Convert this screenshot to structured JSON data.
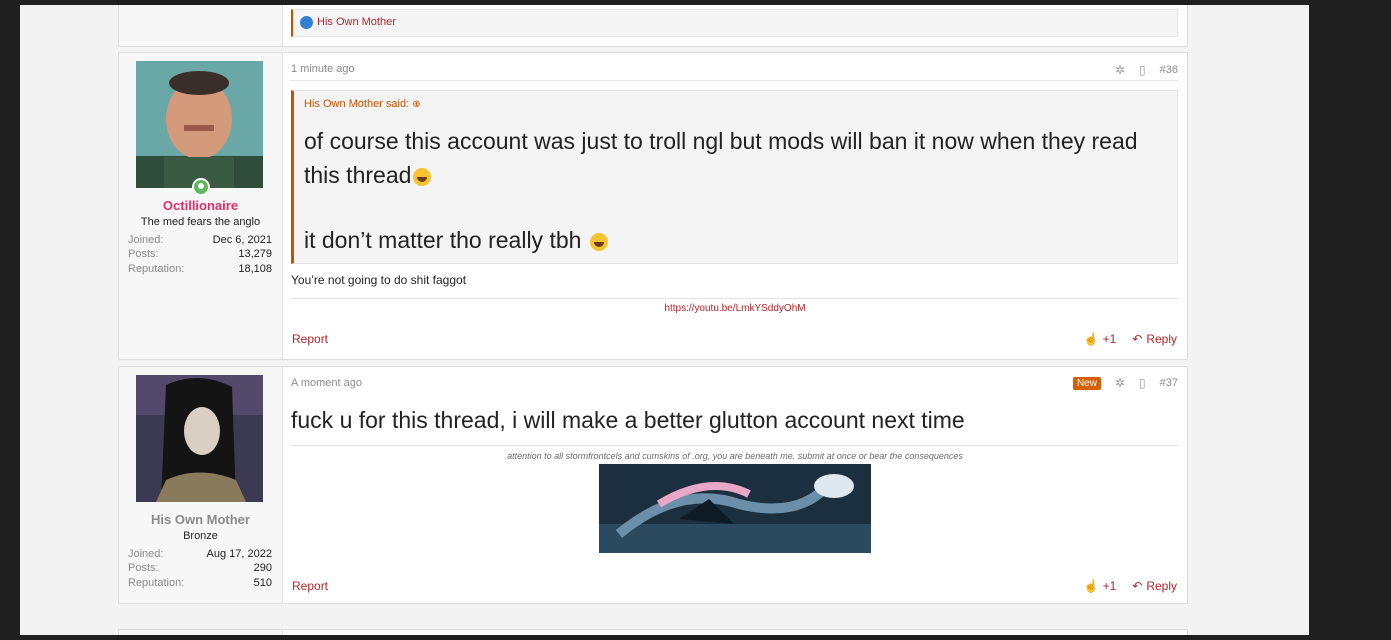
{
  "prev_post": {
    "reaction_user": "His Own Mother"
  },
  "post36": {
    "time": "1 minute ago",
    "number": "#36",
    "quote": {
      "author": "His Own Mother said:",
      "line1": "of course this account was just to troll ngl but mods will ban it now when they read",
      "line2": "this thread",
      "line3": "it don’t matter tho really tbh "
    },
    "body": "You’re not going to do shit faggot",
    "signature_link": "https://youtu.be/LmkYSddyOhM",
    "report_label": "Report",
    "like_count": "+1",
    "reply_label": "Reply",
    "user": {
      "name": "Octillionaire",
      "name_color": "#e0306a",
      "title": "The med fears the anglo",
      "joined_label": "Joined:",
      "joined": "Dec 6, 2021",
      "posts_label": "Posts:",
      "posts": "13,279",
      "rep_label": "Reputation:",
      "reputation": "18,108"
    }
  },
  "post37": {
    "time": "A moment ago",
    "badge": "New",
    "number": "#37",
    "body": "fuck u for this thread, i will make a better glutton account next time",
    "signature_text": "attention to all stormfrontcels and cumskins of .org, you are beneath me. submit at once or bear the consequences",
    "report_label": "Report",
    "like_count": "+1",
    "reply_label": "Reply",
    "user": {
      "name": "His Own Mother",
      "title": "Bronze",
      "joined_label": "Joined:",
      "joined": "Aug 17, 2022",
      "posts_label": "Posts:",
      "posts": "290",
      "rep_label": "Reputation:",
      "reputation": "510"
    }
  },
  "colors": {
    "accent": "#b0262c",
    "quote_accent": "#c45200",
    "online": "#5cb85c"
  },
  "icons": [
    "like-icon",
    "share-icon",
    "bookmark-icon",
    "thumbs-up-icon",
    "reply-icon",
    "quote-arrow-icon",
    "laughing-emoji-icon"
  ]
}
